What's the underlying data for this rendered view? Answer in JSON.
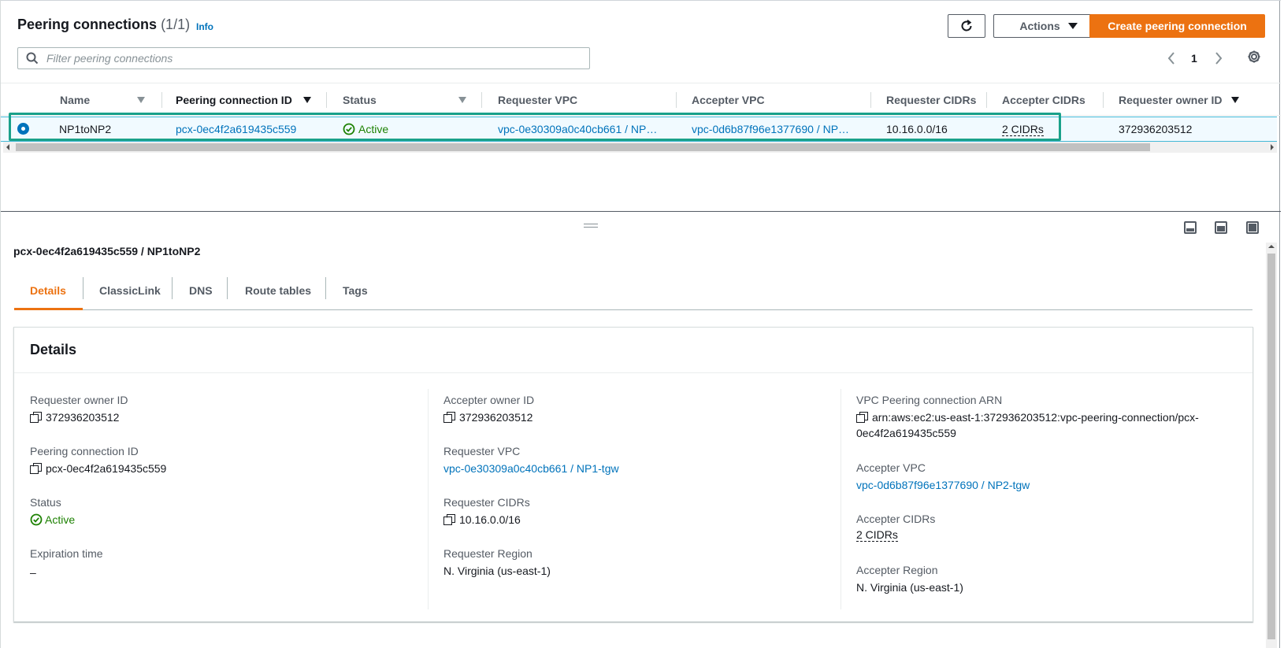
{
  "header": {
    "title": "Peering connections",
    "count": "(1/1)",
    "info": "Info",
    "actions_label": "Actions",
    "create_label": "Create peering connection",
    "search_placeholder": "Filter peering connections",
    "page": "1"
  },
  "table": {
    "columns": [
      "Name",
      "Peering connection ID",
      "Status",
      "Requester VPC",
      "Accepter VPC",
      "Requester CIDRs",
      "Accepter CIDRs",
      "Requester owner ID"
    ],
    "row": {
      "name": "NP1toNP2",
      "peering_id": "pcx-0ec4f2a619435c559",
      "status": "Active",
      "requester_vpc": "vpc-0e30309a0c40cb661 / NP…",
      "accepter_vpc": "vpc-0d6b87f96e1377690 / NP…",
      "requester_cidrs": "10.16.0.0/16",
      "accepter_cidrs": "2 CIDRs",
      "requester_owner": "372936203512"
    }
  },
  "detail": {
    "title": "pcx-0ec4f2a619435c559 / NP1toNP2",
    "tabs": [
      "Details",
      "ClassicLink",
      "DNS",
      "Route tables",
      "Tags"
    ],
    "card_title": "Details",
    "col1": {
      "requester_owner_label": "Requester owner ID",
      "requester_owner_value": "372936203512",
      "peering_id_label": "Peering connection ID",
      "peering_id_value": "pcx-0ec4f2a619435c559",
      "status_label": "Status",
      "status_value": "Active",
      "expiration_label": "Expiration time",
      "expiration_value": "–"
    },
    "col2": {
      "accepter_owner_label": "Accepter owner ID",
      "accepter_owner_value": "372936203512",
      "requester_vpc_label": "Requester VPC",
      "requester_vpc_value": "vpc-0e30309a0c40cb661 / NP1-tgw",
      "requester_cidrs_label": "Requester CIDRs",
      "requester_cidrs_value": "10.16.0.0/16",
      "requester_region_label": "Requester Region",
      "requester_region_value": "N. Virginia (us-east-1)"
    },
    "col3": {
      "arn_label": "VPC Peering connection ARN",
      "arn_value_line1": "arn:aws:ec2:us-east-1:372936203512:vpc-peering-connection/pcx-",
      "arn_value_line2": "0ec4f2a619435c559",
      "accepter_vpc_label": "Accepter VPC",
      "accepter_vpc_value": "vpc-0d6b87f96e1377690 / NP2-tgw",
      "accepter_cidrs_label": "Accepter CIDRs",
      "accepter_cidrs_value": "2 CIDRs",
      "accepter_region_label": "Accepter Region",
      "accepter_region_value": "N. Virginia (us-east-1)"
    }
  },
  "colors": {
    "accent": "#ec7211",
    "link": "#0073bb",
    "success": "#1d8102",
    "selection_border": "#1aa18a"
  }
}
